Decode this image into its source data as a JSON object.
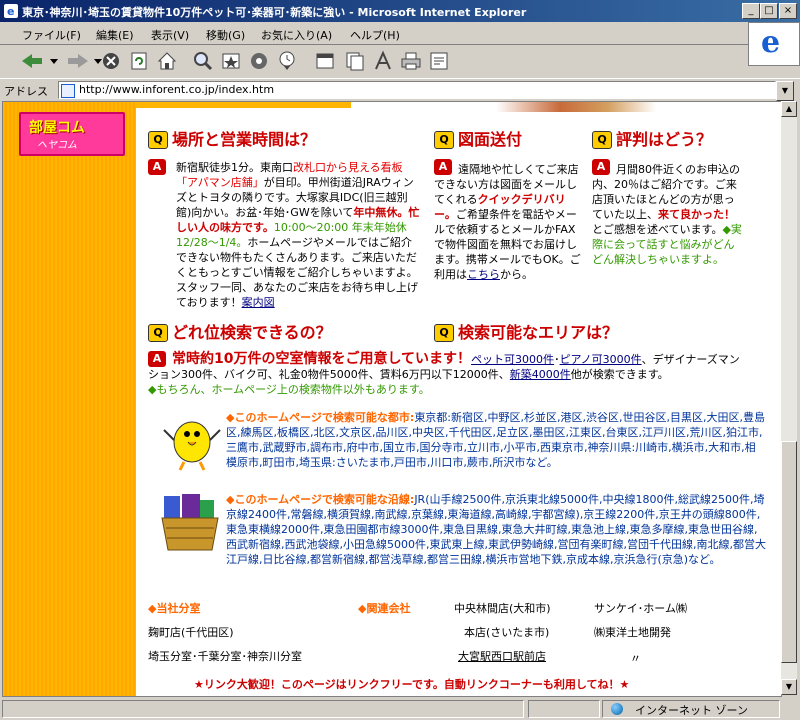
{
  "window": {
    "title": "東京･神奈川･埼玉の賃貸物件10万件ペット可･楽器可･新築に強い - Microsoft Internet Explorer"
  },
  "menu": [
    "ファイル(F)",
    "編集(E)",
    "表示(V)",
    "移動(G)",
    "お気に入り(A)",
    "ヘルプ(H)"
  ],
  "address": {
    "label": "アドレス",
    "url": "http://www.inforent.co.jp/index.htm"
  },
  "status": {
    "zone": "インターネット ゾーン"
  },
  "banner": {
    "line1": "部屋コム",
    "line2": "ヘヤコム"
  },
  "sections": {
    "q_location": "場所と営業時間は？",
    "q_fax": "図面送付",
    "q_reviews": "評判はどう？",
    "q_search": "どれ位検索できるの？",
    "q_area": "検索可能なエリアは？"
  },
  "location": {
    "t1": "新宿駅徒歩1分。東南口",
    "t2": "改札口から見える看板「アパマン店舗」",
    "t3": "が目印。甲州街道沿JRAウィンズとトヨタの隣りです。大塚家具IDC(旧三越別館)向かい。お盆･年始･GWを除いて",
    "t4": "年中無休。忙しい人の味方です。",
    "t5": "10:00～20:00 年末年始休 12/28～1/4。",
    "t6": "ホームページやメールではご紹介できない物件もたくさんあります。ご来店いただくともっとすごい情報をご紹介しちゃいますよ。スタッフ一同、あなたのご来店をお待ち申し上げております！",
    "map_link": "案内図"
  },
  "fax": {
    "t1": "遠隔地や忙しくてご来店できない方は図面をメールしてくれる",
    "t2": "クイックデリバリー。",
    "t3": "ご希望条件を電話やメールで依頼するとメールかFAXで物件図面を無料でお届けします。携帯メールでもOK。ご利用は",
    "link": "こちら",
    "t4": "から。"
  },
  "reviews": {
    "t1": "月間80件近くのお申込の内、20％はご紹介です。ご来店頂いたほとんどの方が思っていた以上、",
    "t2": "来て良かった！",
    "t3": "とご感想を述べています。",
    "t4": "◆実際に会って話すと悩みがどんどん解決しちゃいますよ。"
  },
  "search": {
    "headline": "常時約10万件の空室情報をご用意しています！",
    "l1": "ペット可3000件",
    "sep": "･",
    "l2": "ピアノ可3000件",
    "t1": "、デザイナーズマンション300件、バイク可、礼金0物件5000件、賃料6万円以下12000件、",
    "l3": "新築4000件",
    "t2": "他が検索できます。",
    "t3": "◆もちろん、ホームページ上の検索物件以外もあります。"
  },
  "cities": {
    "head": "◆このホームページで検索可能な都市:",
    "body": "東京都:新宿区,中野区,杉並区,港区,渋谷区,世田谷区,目黒区,大田区,豊島区,練馬区,板橋区,北区,文京区,品川区,中央区,千代田区,足立区,墨田区,江東区,台東区,江戸川区,荒川区,狛江市,三鷹市,武蔵野市,調布市,府中市,国立市,国分寺市,立川市,小平市,西東京市,神奈川県:川崎市,横浜市,大和市,相模原市,町田市,埼玉県:さいたま市,戸田市,川口市,蕨市,所沢市など。"
  },
  "lines": {
    "head": "◆このホームページで検索可能な沿線:",
    "body": "JR(山手線2500件,京浜東北線5000件,中央線1800件,総武線2500件,埼京線2400件,常磐線,横須賀線,南武線,京葉線,東海道線,高崎線,宇都宮線),京王線2200件,京王井の頭線800件,東急東横線2000件,東急田園都市線3000件,東急目黒線,東急大井町線,東急池上線,東急多摩線,東急世田谷線,西武新宿線,西武池袋線,小田急線5000件,東武東上線,東武伊勢崎線,営団有楽町線,営団千代田線,南北線,都営大江戸線,日比谷線,都営新宿線,都営浅草線,都営三田線,横浜市営地下鉄,京成本線,京浜急行(京急)など。"
  },
  "branches": {
    "head": "◆当社分室",
    "b1": "麹町店(千代田区)",
    "b2": "埼玉分室･千葉分室･神奈川分室"
  },
  "related": {
    "head": "◆関連会社",
    "c1": "中央林間店(大和市)",
    "c2": "本店(さいたま市)",
    "c3": "大宮駅西口駅前店",
    "c4": "サンケイ･ホーム㈱",
    "c5": "㈱東洋土地開発",
    "c6": "〃"
  },
  "footer": "★リンク大歓迎！このページはリンクフリーです。自動リンクコーナーも利用してね！★"
}
